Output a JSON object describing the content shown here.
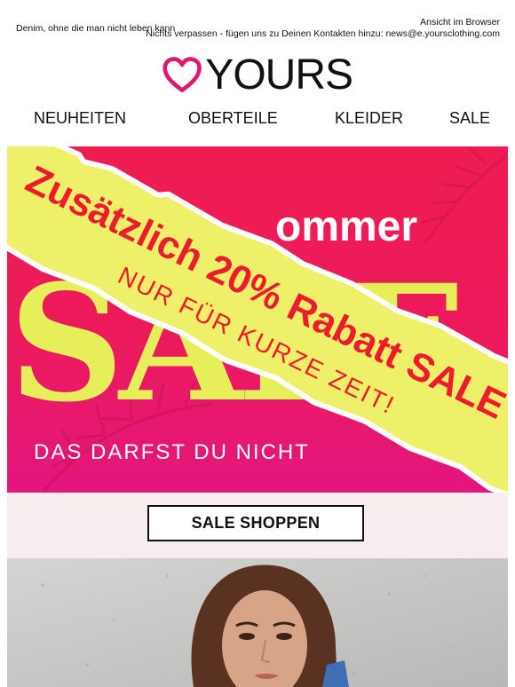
{
  "preheader": {
    "tagline": "Denim, ohne die man nicht leben kann",
    "view_in_browser": "Ansicht im Browser",
    "contact_note": "Nichts verpassen - fügen uns zu Deinen Kontakten hinzu: news@e.yoursclothing.com"
  },
  "logo": {
    "text": "YOURS",
    "icon": "heart-icon",
    "color": "#e0176f"
  },
  "nav": {
    "items": [
      "NEUHEITEN",
      "OBERTEILE",
      "KLEIDER",
      "SALE"
    ]
  },
  "hero": {
    "headline": "ommer",
    "big_word": "SALE",
    "subline": "DAS DARFST DU NICHT",
    "tape_line1": "Zusätzlich 20% Rabatt SALE",
    "tape_line2": "NUR FÜR KURZE ZEIT!",
    "colors": {
      "hot_pink": "#ef1c52",
      "magenta": "#e3167e",
      "tape_yellow": "#eef06a",
      "text_red": "#ee1b2e",
      "lime": "#e6ef5a"
    }
  },
  "cta": {
    "label": "SALE SHOPPEN"
  }
}
